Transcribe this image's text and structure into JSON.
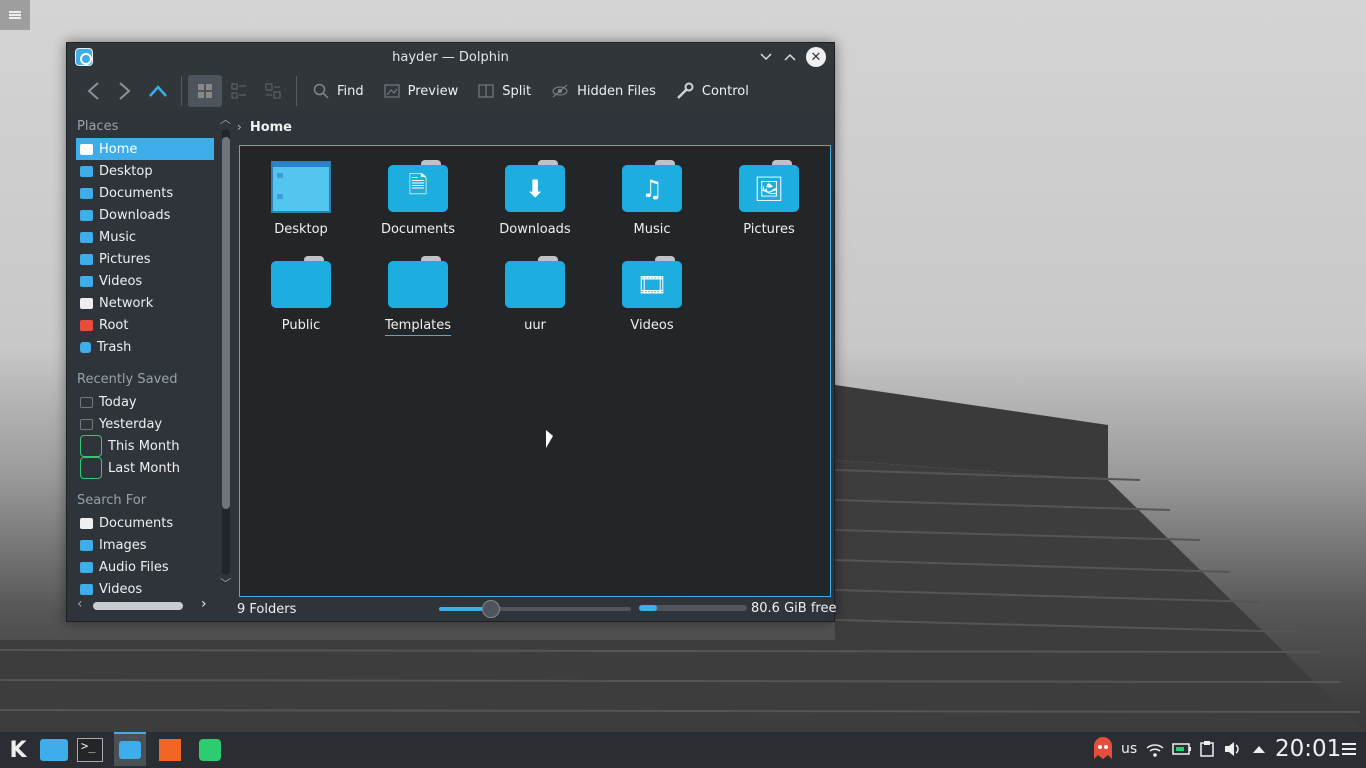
{
  "window": {
    "title": "hayder — Dolphin"
  },
  "toolbar": {
    "find": "Find",
    "preview": "Preview",
    "split": "Split",
    "hidden_files": "Hidden Files",
    "control": "Control"
  },
  "sidebar": {
    "places_heading": "Places",
    "places": [
      {
        "label": "Home",
        "icon": "home-icon"
      },
      {
        "label": "Desktop",
        "icon": "folder-icon"
      },
      {
        "label": "Documents",
        "icon": "folder-icon"
      },
      {
        "label": "Downloads",
        "icon": "folder-icon"
      },
      {
        "label": "Music",
        "icon": "folder-icon"
      },
      {
        "label": "Pictures",
        "icon": "folder-icon"
      },
      {
        "label": "Videos",
        "icon": "folder-icon"
      },
      {
        "label": "Network",
        "icon": "network-icon"
      },
      {
        "label": "Root",
        "icon": "root-folder-icon"
      },
      {
        "label": "Trash",
        "icon": "trash-icon"
      }
    ],
    "recent_heading": "Recently Saved",
    "recent": [
      {
        "label": "Today"
      },
      {
        "label": "Yesterday"
      },
      {
        "label": "This Month"
      },
      {
        "label": "Last Month"
      }
    ],
    "search_heading": "Search For",
    "search": [
      {
        "label": "Documents"
      },
      {
        "label": "Images"
      },
      {
        "label": "Audio Files"
      },
      {
        "label": "Videos"
      }
    ]
  },
  "breadcrumb": {
    "current": "Home"
  },
  "files": [
    {
      "name": "Desktop",
      "glyph": ""
    },
    {
      "name": "Documents",
      "glyph": "🗎"
    },
    {
      "name": "Downloads",
      "glyph": "⬇"
    },
    {
      "name": "Music",
      "glyph": "♫"
    },
    {
      "name": "Pictures",
      "glyph": "🖼"
    },
    {
      "name": "Public",
      "glyph": ""
    },
    {
      "name": "Templates",
      "glyph": ""
    },
    {
      "name": "uur",
      "glyph": ""
    },
    {
      "name": "Videos",
      "glyph": "🎞"
    }
  ],
  "status": {
    "count": "9 Folders",
    "zoom_fraction": 0.27,
    "space_used_fraction": 0.17,
    "free": "80.6 GiB free"
  },
  "tray": {
    "keyboard_layout": "us",
    "clock": "20:01"
  },
  "colors": {
    "accent": "#3daee9",
    "window_bg": "#2f343b",
    "view_bg": "#232629"
  }
}
